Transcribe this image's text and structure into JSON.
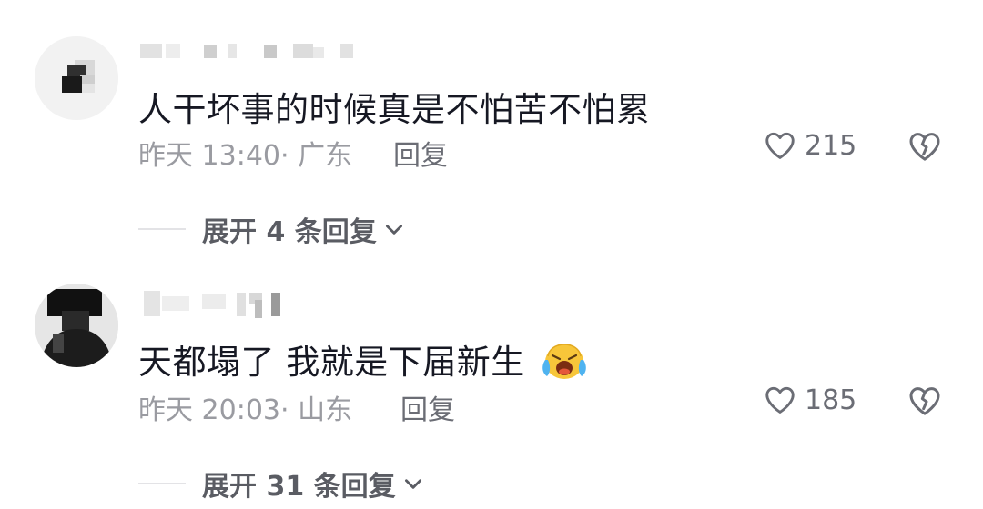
{
  "comments": [
    {
      "text": "人干坏事的时候真是不怕苦不怕累",
      "time": "昨天 13:40",
      "location": "· 广东",
      "reply_label": "回复",
      "likes": "215",
      "expand_label": "展开 4 条回复"
    },
    {
      "text": "天都塌了 我就是下届新生",
      "emoji": "crying-face-emoji",
      "time": "昨天 20:03",
      "location": "· 山东",
      "reply_label": "回复",
      "likes": "185",
      "expand_label": "展开 31 条回复"
    }
  ],
  "icons": {
    "like": "heart-outline-icon",
    "dislike": "broken-heart-icon",
    "expand": "chevron-down-icon"
  },
  "colors": {
    "text": "#161823",
    "meta": "#9a9ba1",
    "secondary": "#6b6d75"
  }
}
